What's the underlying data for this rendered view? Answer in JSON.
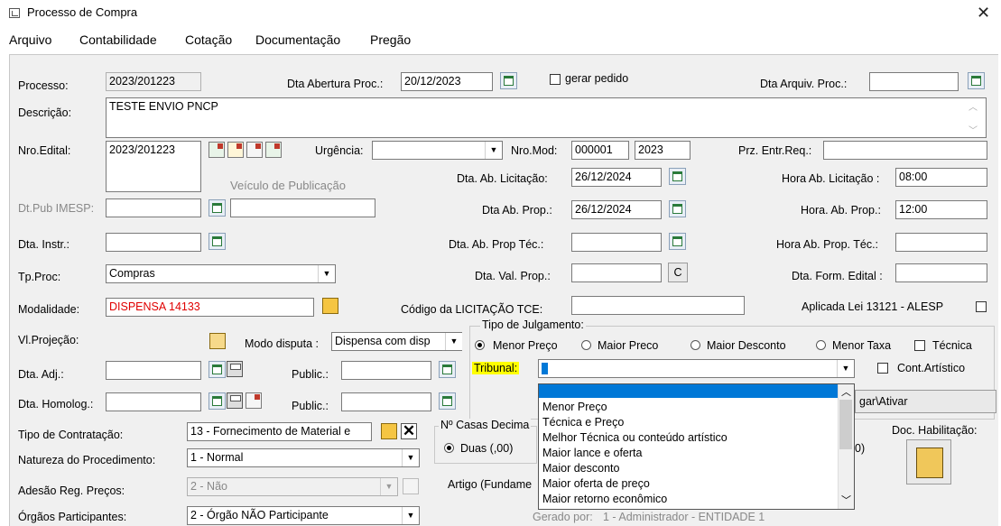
{
  "window": {
    "title": "Processo de Compra"
  },
  "menu": [
    "Arquivo",
    "Contabilidade",
    "Cotação",
    "Documentação",
    "Pregão"
  ],
  "labels": {
    "processo": "Processo:",
    "dta_abertura": "Dta Abertura Proc.:",
    "gerar_pedido": "gerar pedido",
    "dta_arquiv": "Dta Arquiv. Proc.:",
    "descricao": "Descrição:",
    "nro_edital": "Nro.Edital:",
    "urgencia": "Urgência:",
    "nro_mod": "Nro.Mod:",
    "prz_entr": "Prz. Entr.Req.:",
    "dta_ab_licitacao": "Dta. Ab. Licitação:",
    "hora_ab_licitacao": "Hora Ab. Licitação :",
    "veiculo": "Veículo de Publicação",
    "dt_pub_imesp": "Dt.Pub IMESP:",
    "dta_ab_prop": "Dta Ab. Prop.:",
    "hora_ab_prop": "Hora. Ab. Prop.:",
    "dta_instr": "Dta. Instr.:",
    "dta_ab_prop_tec": "Dta. Ab. Prop Téc.:",
    "hora_ab_prop_tec": "Hora Ab. Prop. Téc.:",
    "tp_proc": "Tp.Proc:",
    "dta_val_prop": "Dta. Val. Prop.:",
    "dta_form_edital": "Dta. Form. Edital :",
    "modalidade": "Modalidade:",
    "codigo_licitacao": "Código da LICITAÇÃO TCE:",
    "aplicada_lei": "Aplicada Lei 13121 - ALESP",
    "vl_projecao": "Vl.Projeção:",
    "modo_disputa": "Modo disputa :",
    "tipo_julgamento": "Tipo de Julgamento:",
    "dta_adj": "Dta. Adj.:",
    "public1": "Public.:",
    "tribunal": "Tribunal:",
    "cont_artistico": "Cont.Artístico",
    "dta_homolog": "Dta. Homolog.:",
    "public2": "Public.:",
    "tipo_contratacao": "Tipo de Contratação:",
    "casas_decimais": "Nº Casas Decima",
    "duas": "Duas (,00)",
    "doc_habilitacao": "Doc. Habilitação:",
    "natureza": "Natureza do Procedimento:",
    "adesao": "Adesão Reg. Preços:",
    "artigo": "Artigo (Fundame",
    "orgaos": "Órgãos Participantes:",
    "gerado_por": "Gerado por:"
  },
  "values": {
    "processo": "2023/201223",
    "dta_abertura": "20/12/2023",
    "descricao": "TESTE ENVIO PNCP",
    "nro_edital": "2023/201223",
    "nro_mod_1": "000001",
    "nro_mod_2": "2023",
    "dta_ab_licitacao": "26/12/2024",
    "hora_ab_licitacao": "08:00",
    "dta_ab_prop": "26/12/2024",
    "hora_ab_prop": "12:00",
    "tp_proc": "Compras",
    "modalidade": "DISPENSA 14133",
    "modo_disputa": "Dispensa com disp",
    "tipo_contratacao": "13 - Fornecimento de Material e",
    "natureza": "1 - Normal",
    "adesao": "2 - Não",
    "orgaos": "2 - Órgão NÃO Participante",
    "gerado_por": "1 - Administrador - ENTIDADE 1",
    "val_prop_btn": "C",
    "partial_btn": "gar\\Ativar",
    "partial_right": "0)"
  },
  "tipo_julgamento_options": [
    "Menor Preço",
    "Maior Preco",
    "Maior Desconto",
    "Menor Taxa",
    "Técnica"
  ],
  "tribunal_dropdown": {
    "selected": "",
    "options": [
      "Menor Preço",
      "Técnica e Preço",
      "Melhor Técnica ou conteúdo artístico",
      "Maior lance e oferta",
      "Maior desconto",
      "Maior oferta de preço",
      "Maior retorno econômico"
    ]
  },
  "colors": {
    "selection": "#0078d7",
    "highlight": "#ffff00",
    "alert_text": "#e00000"
  }
}
